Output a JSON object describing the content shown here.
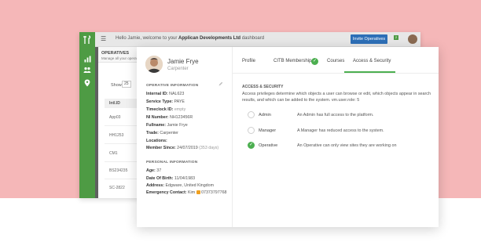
{
  "colors": {
    "background": "#f5b7b8",
    "brand_green": "#4e9b44",
    "check_green": "#4caf50",
    "invite_blue": "#2d6fb7"
  },
  "app": {
    "welcome_prefix": "Hello Jamie, welcome to your",
    "company": "Applican Developments Ltd",
    "welcome_suffix": "dashboard",
    "invite_label": "Invite Operatives",
    "notifications": "2",
    "sidebar_icons": [
      "chart-icon",
      "users-icon",
      "location-pin-icon"
    ],
    "operatives_title": "OPERATIVES",
    "operatives_sub": "Manage all your operatives",
    "show_label": "Show",
    "show_value": "25",
    "table_header": "Intl.ID",
    "table_rows": [
      "App03",
      "HH1253",
      "CM1",
      "BS234235",
      "SC-2822"
    ]
  },
  "profile": {
    "name": "Jamie Frye",
    "role": "Carpenter",
    "operative_info_label": "OPERATIVE INFORMATION",
    "fields": [
      {
        "label": "Internal ID:",
        "value": "NAL623"
      },
      {
        "label": "Service Type:",
        "value": "PAYE"
      },
      {
        "label": "Timeclock ID:",
        "value": "empty"
      },
      {
        "label": "NI Number:",
        "value": "NH123456R"
      },
      {
        "label": "Fullname:",
        "value": "Jamie Frye"
      },
      {
        "label": "Trade:",
        "value": "Carpenter"
      },
      {
        "label": "Locations:",
        "value": ""
      },
      {
        "label": "Member Since:",
        "value": "24/07/2019",
        "extra": "(353 days)"
      }
    ],
    "personal_info_label": "PERSONAL INFORMATION",
    "personal": [
      {
        "label": "Age:",
        "value": "37"
      },
      {
        "label": "Date Of Birth:",
        "value": "11/04/1983"
      },
      {
        "label": "Address:",
        "value": "Edgware, United Kingdom"
      },
      {
        "label": "Emergency Contact:",
        "value": "Kim",
        "phone": "07373797768"
      }
    ]
  },
  "tabs": [
    {
      "label": "Profile"
    },
    {
      "label": "CITB Membership"
    },
    {
      "label": "Courses"
    },
    {
      "label": "Access & Security",
      "active": true
    }
  ],
  "access": {
    "title": "ACCESS & SECURITY",
    "description": "Access privileges determine which objects a user can browse or edit, which objects appear in search results, and which can be added to the system. vm.user.role: 5",
    "roles": [
      {
        "name": "Admin",
        "desc": "An Admin has full access to the platform.",
        "checked": false
      },
      {
        "name": "Manager",
        "desc": "A Manager has reduced access to the system.",
        "checked": false
      },
      {
        "name": "Operative",
        "desc": "An Operative can only view sites they are working on",
        "checked": true
      }
    ]
  }
}
